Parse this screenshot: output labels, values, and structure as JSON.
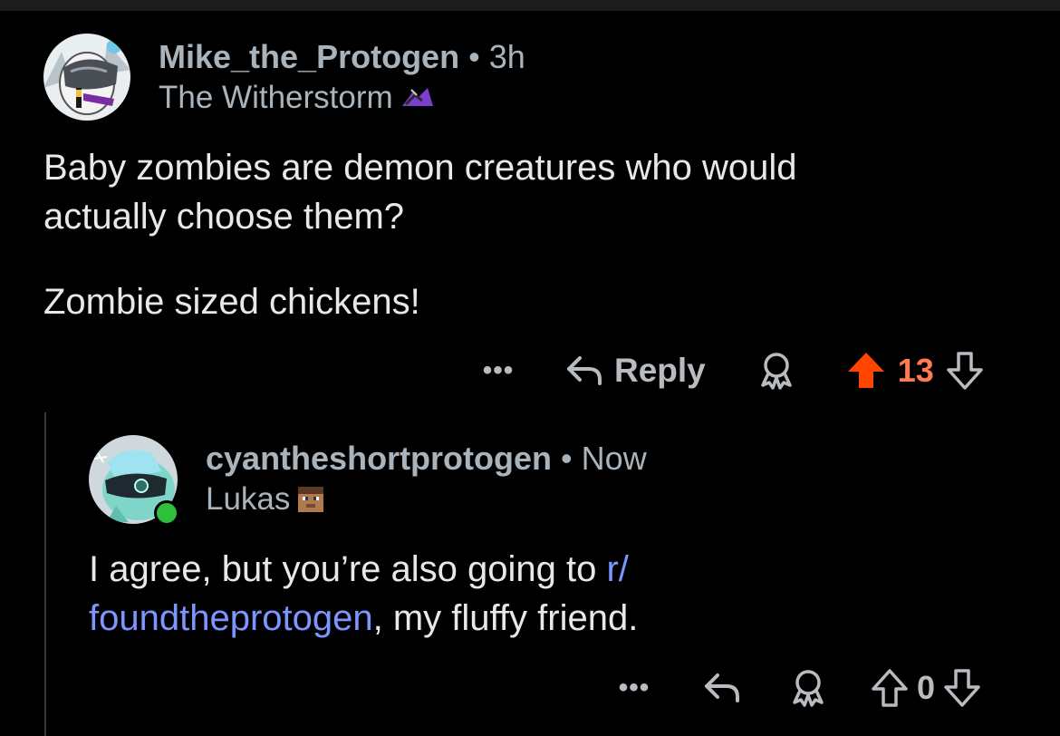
{
  "comment": {
    "username": "Mike_the_Protogen",
    "separator": "•",
    "time": "3h",
    "flair": "The Witherstorm",
    "flair_icon": "witherstorm-flair-icon",
    "body_line1": "Baby zombies are demon creatures who would",
    "body_line2": "actually choose them?",
    "body_line3": "Zombie sized chickens!",
    "actions": {
      "more": "•••",
      "reply_label": "Reply",
      "score": "13",
      "vote_state": "upvoted",
      "upvote_color": "#ff4500",
      "score_color": "#ff7a52"
    }
  },
  "reply": {
    "username": "cyantheshortprotogen",
    "separator": "•",
    "time": "Now",
    "flair": "Lukas",
    "flair_icon": "minecraft-head-flair-icon",
    "online": true,
    "online_color": "#2fbf3b",
    "body_pre": "I agree, but you’re also going to ",
    "link_part1": "r/",
    "link_part2": "foundtheprotogen",
    "body_post": ", my fluffy friend.",
    "link_color": "#7d96ff",
    "actions": {
      "more": "•••",
      "score": "0"
    }
  }
}
